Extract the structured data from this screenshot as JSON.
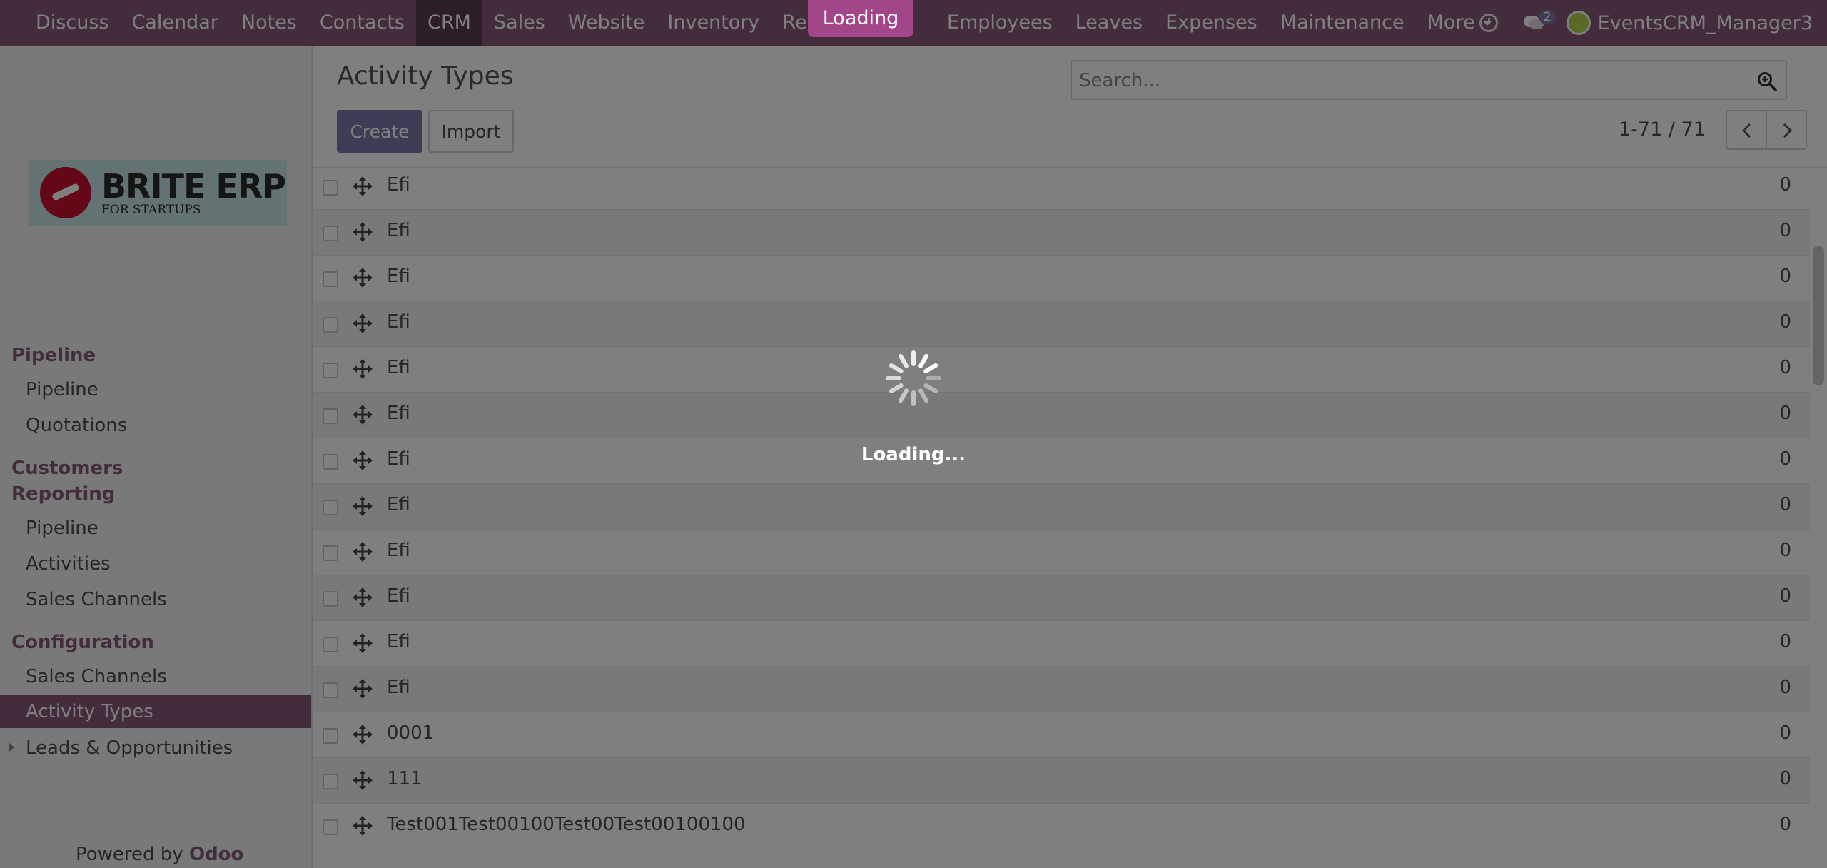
{
  "navbar": {
    "apps": [
      "Discuss",
      "Calendar",
      "Notes",
      "Contacts",
      "CRM",
      "Sales",
      "Website",
      "Inventory",
      "Repairs",
      "Loading",
      "Employees",
      "Leaves",
      "Expenses",
      "Maintenance"
    ],
    "active_app": "CRM",
    "more_label": "More",
    "messages_count": "2",
    "user_name": "EventsCRM_Manager3"
  },
  "sidebar": {
    "logo": {
      "title": "BRITE ERP",
      "subtitle": "FOR STARTUPS"
    },
    "sections": [
      {
        "title": "Pipeline",
        "items": [
          "Pipeline",
          "Quotations"
        ]
      },
      {
        "title": "Customers Reporting",
        "items": [
          "Pipeline",
          "Activities",
          "Sales Channels"
        ]
      },
      {
        "title": "Configuration",
        "items": [
          "Sales Channels",
          "Activity Types"
        ]
      }
    ],
    "active_item": "Activity Types",
    "collapsed_item": "Leads & Opportunities",
    "powered_by": "Powered by",
    "powered_brand": "Odoo"
  },
  "control_panel": {
    "title": "Activity Types",
    "search_placeholder": "Search...",
    "create_label": "Create",
    "import_label": "Import",
    "pager": "1-71 / 71"
  },
  "list": {
    "rows": [
      {
        "name": "Efi",
        "count": "0"
      },
      {
        "name": "Efi",
        "count": "0"
      },
      {
        "name": "Efi",
        "count": "0"
      },
      {
        "name": "Efi",
        "count": "0"
      },
      {
        "name": "Efi",
        "count": "0"
      },
      {
        "name": "Efi",
        "count": "0"
      },
      {
        "name": "Efi",
        "count": "0"
      },
      {
        "name": "Efi",
        "count": "0"
      },
      {
        "name": "Efi",
        "count": "0"
      },
      {
        "name": "Efi",
        "count": "0"
      },
      {
        "name": "Efi",
        "count": "0"
      },
      {
        "name": "Efi",
        "count": "0"
      },
      {
        "name": "0001",
        "count": "0"
      },
      {
        "name": "111",
        "count": "0"
      },
      {
        "name": "Test001Test00100Test00Test00100100",
        "count": "0"
      }
    ]
  },
  "overlay": {
    "message": "Loading..."
  },
  "colors": {
    "brand": "#875a7b",
    "primary_button": "#7c7bad",
    "loading_pill": "#a24689"
  }
}
